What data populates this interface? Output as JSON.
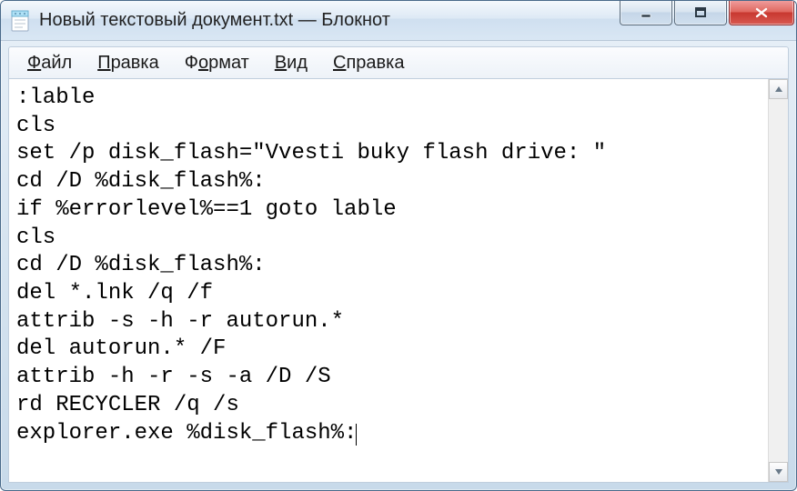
{
  "window": {
    "title": "Новый текстовый документ.txt — Блокнот"
  },
  "menubar": {
    "items": [
      {
        "label": "Файл",
        "accel_index": 0
      },
      {
        "label": "Правка",
        "accel_index": 0
      },
      {
        "label": "Формат",
        "accel_index": 1
      },
      {
        "label": "Вид",
        "accel_index": 0
      },
      {
        "label": "Справка",
        "accel_index": 0
      }
    ]
  },
  "editor": {
    "content": ":lable\ncls\nset /p disk_flash=\"Vvesti buky flash drive: \"\ncd /D %disk_flash%:\nif %errorlevel%==1 goto lable\ncls\ncd /D %disk_flash%:\ndel *.lnk /q /f\nattrib -s -h -r autorun.*\ndel autorun.* /F\nattrib -h -r -s -a /D /S\nrd RECYCLER /q /s\nexplorer.exe %disk_flash%:"
  }
}
